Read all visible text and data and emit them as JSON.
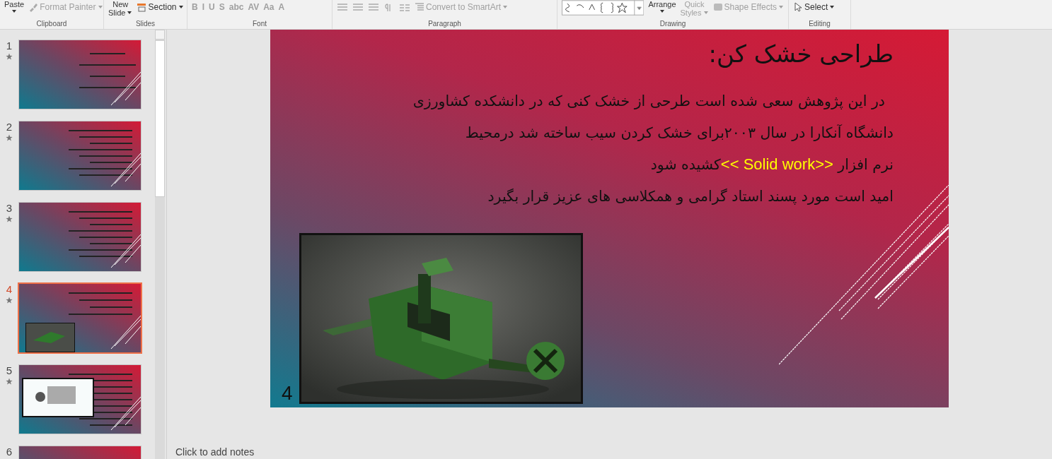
{
  "ribbon": {
    "groups": [
      {
        "label": "Clipboard",
        "commands": [
          {
            "kind": "big",
            "label": "Paste",
            "disabled": false
          },
          {
            "kind": "brush",
            "label": "Format Painter",
            "disabled": true
          }
        ]
      },
      {
        "label": "Slides",
        "commands": [
          {
            "kind": "big",
            "label": "New",
            "sublabel": "Slide",
            "disabled": false
          },
          {
            "kind": "section",
            "label": "Section",
            "disabled": false
          }
        ]
      },
      {
        "label": "Font",
        "commands": [
          {
            "kind": "glyph",
            "label": "B",
            "disabled": true
          },
          {
            "kind": "glyph",
            "label": "I",
            "disabled": true
          },
          {
            "kind": "glyph",
            "label": "U",
            "disabled": true
          },
          {
            "kind": "glyph",
            "label": "S",
            "disabled": true
          },
          {
            "kind": "glyph",
            "label": "abc",
            "disabled": true
          },
          {
            "kind": "glyph",
            "label": "AV",
            "disabled": true
          },
          {
            "kind": "glyph",
            "label": "Aa",
            "disabled": true
          },
          {
            "kind": "glyph",
            "label": "A",
            "disabled": true
          }
        ]
      },
      {
        "label": "Paragraph",
        "commands": [
          {
            "kind": "align"
          },
          {
            "kind": "align"
          },
          {
            "kind": "align"
          },
          {
            "kind": "pilcrow"
          },
          {
            "kind": "columns"
          },
          {
            "kind": "smartart",
            "label": "Convert to SmartArt",
            "disabled": true
          }
        ]
      },
      {
        "label": "Drawing",
        "commands": [
          {
            "kind": "gallery"
          },
          {
            "kind": "big",
            "label": "Arrange",
            "disabled": false
          },
          {
            "kind": "big",
            "label": "Quick",
            "sublabel": "Styles",
            "disabled": true
          },
          {
            "kind": "effects",
            "label": "Shape Effects",
            "disabled": true
          }
        ]
      },
      {
        "label": "Editing",
        "commands": [
          {
            "kind": "select",
            "label": "Select",
            "disabled": false
          }
        ]
      }
    ]
  },
  "slides": [
    {
      "number": "1",
      "starred": true,
      "selected": false,
      "kind": "title"
    },
    {
      "number": "2",
      "starred": true,
      "selected": false,
      "kind": "text"
    },
    {
      "number": "3",
      "starred": true,
      "selected": false,
      "kind": "text"
    },
    {
      "number": "4",
      "starred": true,
      "selected": true
    },
    {
      "number": "5",
      "starred": true,
      "selected": false,
      "kind": "diagram"
    },
    {
      "number": "6",
      "selected": false,
      "kind": "title"
    }
  ],
  "current_slide": {
    "title": "طراحی خشک کن:",
    "lines": [
      [
        {
          "text": "در این پژوهش سعی شده است طرحی از خشک کنی که در دانشکده کشاورزی",
          "highlight": false
        }
      ],
      [
        {
          "text": "دانشگاه آنکارا در سال ۲۰۰۳برای خشک کردن سیب ساخته شد درمحیط",
          "highlight": false
        }
      ],
      [
        {
          "text": "نرم افزار ",
          "highlight": false
        },
        {
          "text": "<< Solid work>>",
          "highlight": true
        },
        {
          "text": "کشیده شود",
          "highlight": false
        }
      ],
      [
        {
          "text": "امید است مورد پسند استاد گرامی و همکلاسی های عزیز قرار بگیرد",
          "highlight": false
        }
      ]
    ],
    "picture": {
      "kind": "picture"
    },
    "slide_number": "4"
  },
  "notes": {
    "placeholder": "Click to add notes"
  }
}
